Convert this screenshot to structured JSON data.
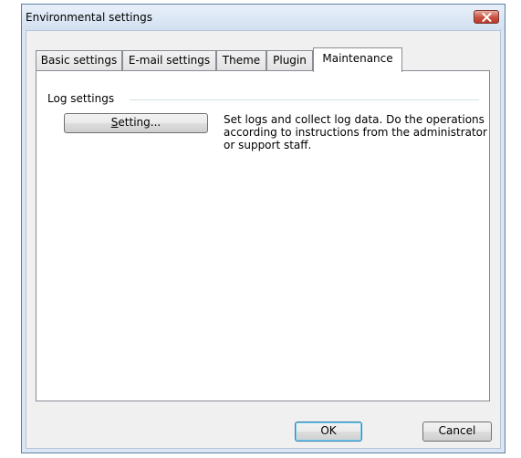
{
  "window": {
    "title": "Environmental settings"
  },
  "tabs": [
    {
      "label": "Basic settings",
      "active": false
    },
    {
      "label": "E-mail settings",
      "active": false
    },
    {
      "label": "Theme",
      "active": false
    },
    {
      "label": "Plugin",
      "active": false
    },
    {
      "label": "Maintenance",
      "active": true
    }
  ],
  "log_settings": {
    "group_title": "Log settings",
    "setting_button_mnemonic": "S",
    "setting_button_rest": "etting...",
    "description": "Set logs and collect log data. Do the operations according to instructions from the administrator or support staff."
  },
  "footer": {
    "ok_label": "OK",
    "cancel_label": "Cancel"
  },
  "icons": {
    "close": "close-icon"
  },
  "colors": {
    "title_bar": "#dbe6f4",
    "close_button": "#c8523f",
    "default_button_border": "#3c7fb1"
  }
}
